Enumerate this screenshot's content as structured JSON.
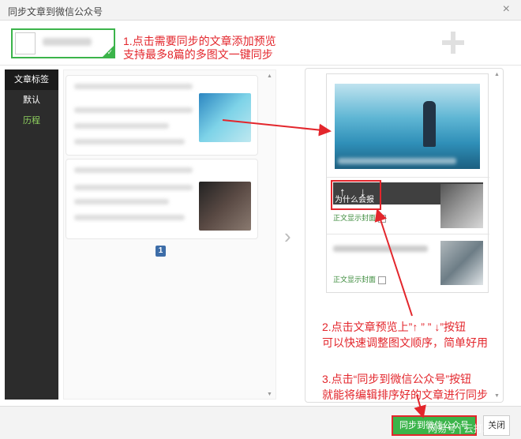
{
  "window": {
    "title": "同步文章到微信公众号",
    "close_icon": "×"
  },
  "annotations": {
    "step1_line1": "1.点击需要同步的文章添加预览",
    "step1_line2": "支持最多8篇的多图文一键同步",
    "step2_line1": "2.点击文章预览上”↑ ” ” ↓”按钮",
    "step2_line2": "可以快速调整图文顺序，简单好用",
    "step3_line1": "3.点击“同步到微信公众号”按钮",
    "step3_line2": "就能将编辑排序好的文章进行同步"
  },
  "sidebar": {
    "items": [
      {
        "label": "文章标签"
      },
      {
        "label": "默认"
      },
      {
        "label": "历程"
      }
    ]
  },
  "pagination": {
    "current": "1"
  },
  "preview": {
    "toolbar": {
      "up": "↑",
      "down": "↓",
      "delete_icon": "🗑",
      "label": "为什么会报"
    },
    "rows": [
      {
        "show_cover": "正文显示封面"
      },
      {
        "show_cover": "正文显示封面"
      }
    ]
  },
  "footer": {
    "sync_label": "同步到微信公众号",
    "close_label": "关闭"
  },
  "watermark": "网易号 | 云打印"
}
